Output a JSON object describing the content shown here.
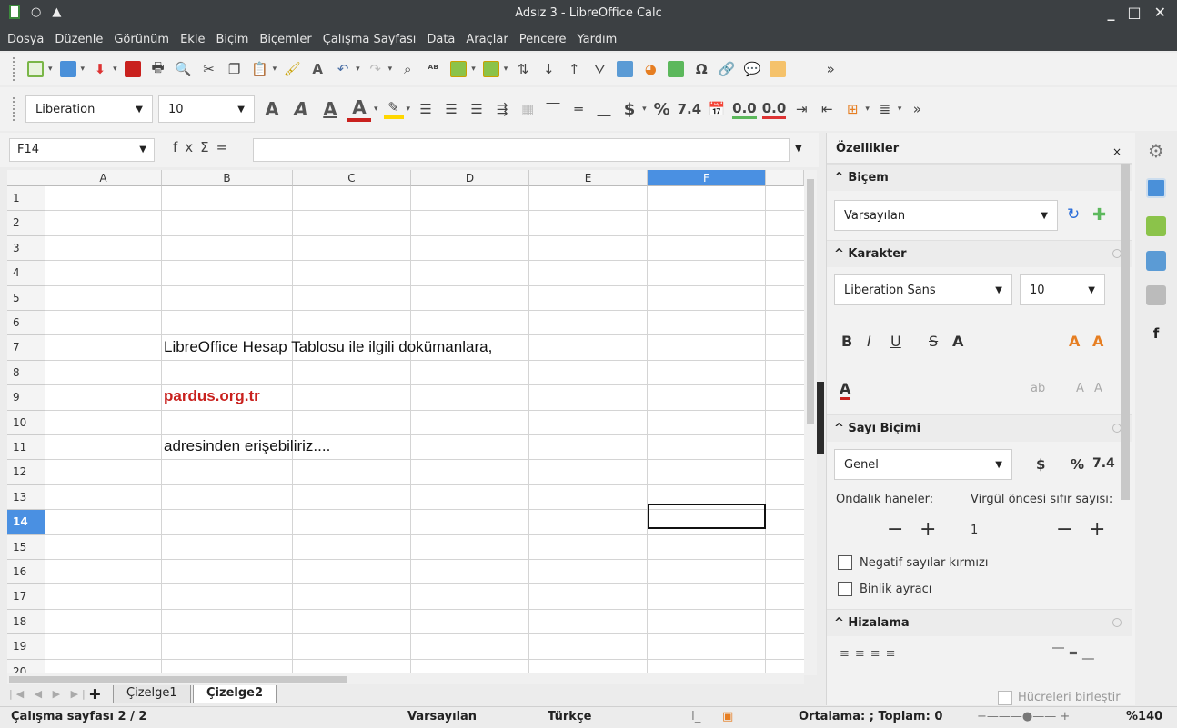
{
  "window": {
    "title": "Adsız 3 - LibreOffice Calc",
    "controls": [
      "_",
      "□",
      "✕"
    ]
  },
  "menu": [
    "Dosya",
    "Düzenle",
    "Görünüm",
    "Ekle",
    "Biçim",
    "Biçemler",
    "Çalışma Sayfası",
    "Data",
    "Araçlar",
    "Pencere",
    "Yardım"
  ],
  "font_toolbar": {
    "font_name": "Liberation",
    "font_size": "10",
    "currency": "$",
    "percent": "%",
    "number_format": "7.4",
    "dec_add": "0.0",
    "dec_del": "0.0"
  },
  "formula": {
    "cell_ref": "F14",
    "fx": "fx",
    "sigma": "Σ",
    "equals": "=",
    "value": ""
  },
  "sheet": {
    "columns": [
      "A",
      "B",
      "C",
      "D",
      "E",
      "F"
    ],
    "rows": [
      "1",
      "2",
      "3",
      "4",
      "5",
      "6",
      "7",
      "8",
      "9",
      "10",
      "11",
      "12",
      "13",
      "14",
      "15",
      "16",
      "17",
      "18",
      "19",
      "20"
    ],
    "selected_column": "F",
    "selected_row": "14",
    "cells": {
      "b7": "LibreOffice Hesap Tablosu ile ilgili dokümanlara,",
      "b9": "pardus.org.tr",
      "b11": "adresinden erişebiliriz...."
    },
    "link_color": "#c9211e"
  },
  "tabs": [
    "Çizelge1",
    "Çizelge2"
  ],
  "active_tab": "Çizelge2",
  "status": {
    "sheet": "Çalışma sayfası 2 / 2",
    "style": "Varsayılan",
    "language": "Türkçe",
    "sum": "Ortalama: ; Toplam: 0",
    "zoom": "%140"
  },
  "sidebar": {
    "title": "Özellikler",
    "close": "×",
    "style_section": "Biçem",
    "style_value": "Varsayılan",
    "char_section": "Karakter",
    "font_name": "Liberation Sans",
    "font_size": "10",
    "bold": "B",
    "italic": "I",
    "underline": "U",
    "number_section": "Sayı Biçimi",
    "number_value": "Genel",
    "currency": "$",
    "percent": "%",
    "numfmt": "7.4",
    "decimals_label": "Ondalık haneler:",
    "leading_zeros_label": "Virgül öncesi sıfır sayısı:",
    "decimals_minus": "−",
    "decimals_plus": "+",
    "leading_zeros_value": "1",
    "zeros_minus": "−",
    "zeros_plus": "+",
    "neg_red": "Negatif sayılar kırmızı",
    "thousands": "Binlik ayracı",
    "align_section": "Hizalama",
    "merge": "Hücreleri birleştir"
  }
}
